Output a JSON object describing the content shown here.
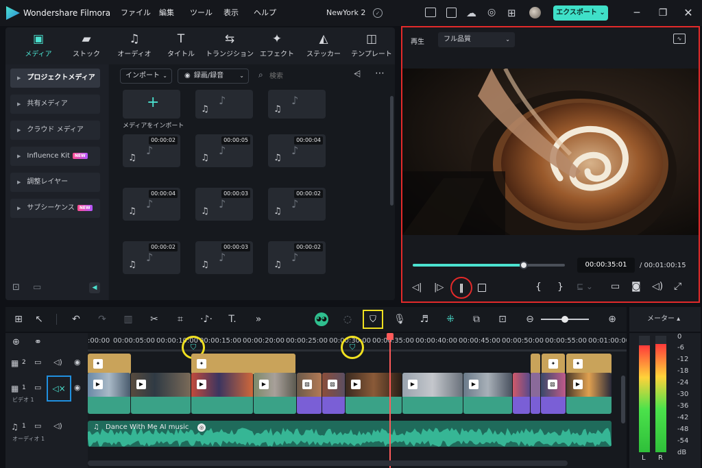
{
  "titlebar": {
    "app_title": "Wondershare Filmora",
    "project": "NewYork 2",
    "menu": [
      "ファイル",
      "編集",
      "ツール",
      "表示",
      "ヘルプ"
    ],
    "export_label": "エクスポート ⌄"
  },
  "left": {
    "tabs": [
      "メディア",
      "ストック",
      "オーディオ",
      "タイトル",
      "トランジション",
      "エフェクト",
      "ステッカー",
      "テンプレート"
    ],
    "sidebar": [
      "プロジェクトメディア",
      "共有メディア",
      "クラウド メディア",
      "Influence Kit",
      "調整レイヤー",
      "サブシーケンス"
    ],
    "new_badge": "NEW",
    "import_dd": "インポート",
    "record_dd": "録画/録音",
    "search_placeholder": "検索",
    "import_media": "メディアをインポート",
    "durations": [
      "00:00:02",
      "00:00:05",
      "00:00:04",
      "00:00:04",
      "00:00:03",
      "00:00:02",
      "00:00:02",
      "00:00:03",
      "00:00:02"
    ]
  },
  "preview": {
    "play_label": "再生",
    "quality": "フル品質",
    "current": "00:00:35:01",
    "total": "/ 00:01:00:15",
    "progress": 0.73
  },
  "timeline": {
    "ticks": [
      ":00:00",
      "00:00:05:00",
      "00:00:10:00",
      "00:00:15:00",
      "00:00:20:00",
      "00:00:25:00",
      "00:00:30:00",
      "00:00:35:00",
      "00:00:40:00",
      "00:00:45:00",
      "00:00:50:00",
      "00:00:55:00",
      "00:01:00:00"
    ],
    "track_v2": "2",
    "track_v1": "1",
    "video_label": "ビデオ 1",
    "track_a1": "1",
    "audio_label": "オーディオ 1",
    "music_title": "Dance With Me AI music"
  },
  "meter": {
    "title": "メーター ▴",
    "scale": [
      "0",
      "-6",
      "-12",
      "-18",
      "-24",
      "-30",
      "-36",
      "-42",
      "-48",
      "-54",
      "dB"
    ],
    "left": "L",
    "right": "R",
    "level_left": 0.92,
    "level_right": 0.93
  },
  "colors": {
    "accent": "#3fe0c8",
    "highlight_red": "#e42a2a",
    "highlight_yellow": "#f0e020",
    "highlight_blue": "#2090e0",
    "title_clip": "#c9a35a",
    "video_clip": "#3aa287",
    "purple_clip": "#7a5fd6"
  }
}
